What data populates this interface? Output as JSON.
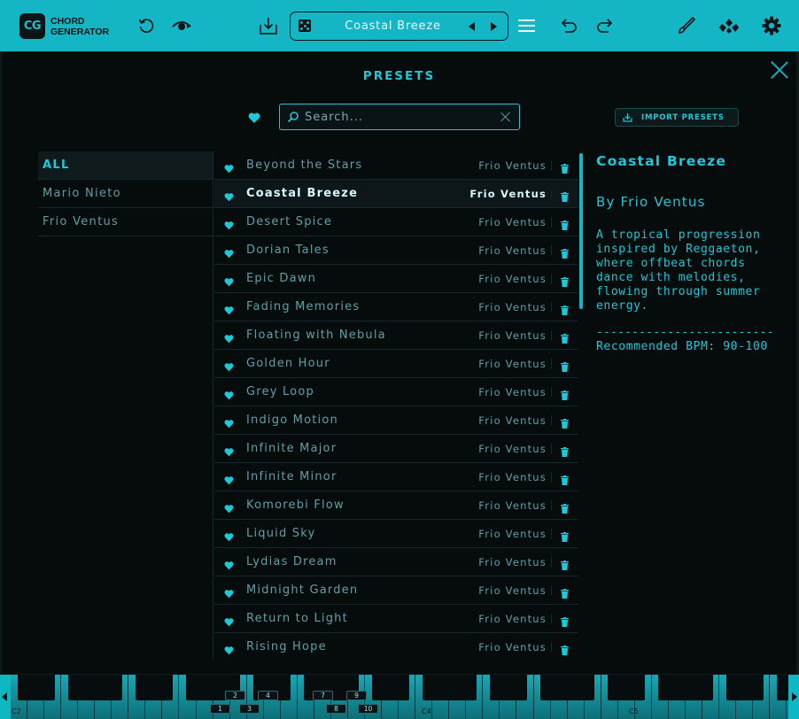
{
  "app": {
    "logo_badge": "CG",
    "logo_line1": "CHORD",
    "logo_line2": "GENERATOR"
  },
  "toolbar": {
    "current_preset": "Coastal Breeze"
  },
  "presets_panel": {
    "title": "PRESETS",
    "search_placeholder": "Search...",
    "import_label": "IMPORT PRESETS",
    "categories": [
      {
        "label": "ALL",
        "active": true
      },
      {
        "label": "Mario Nieto",
        "active": false
      },
      {
        "label": "Frio Ventus",
        "active": false
      }
    ],
    "presets": [
      {
        "name": "Beyond the Stars",
        "author": "Frio Ventus"
      },
      {
        "name": "Coastal Breeze",
        "author": "Frio Ventus",
        "selected": true
      },
      {
        "name": "Desert Spice",
        "author": "Frio Ventus"
      },
      {
        "name": "Dorian Tales",
        "author": "Frio Ventus"
      },
      {
        "name": "Epic Dawn",
        "author": "Frio Ventus"
      },
      {
        "name": "Fading Memories",
        "author": "Frio Ventus"
      },
      {
        "name": "Floating with Nebula",
        "author": "Frio Ventus"
      },
      {
        "name": "Golden Hour",
        "author": "Frio Ventus"
      },
      {
        "name": "Grey Loop",
        "author": "Frio Ventus"
      },
      {
        "name": "Indigo Motion",
        "author": "Frio Ventus"
      },
      {
        "name": "Infinite Major",
        "author": "Frio Ventus"
      },
      {
        "name": "Infinite Minor",
        "author": "Frio Ventus"
      },
      {
        "name": "Komorebi Flow",
        "author": "Frio Ventus"
      },
      {
        "name": "Liquid Sky",
        "author": "Frio Ventus"
      },
      {
        "name": "Lydias Dream",
        "author": "Frio Ventus"
      },
      {
        "name": "Midnight Garden",
        "author": "Frio Ventus"
      },
      {
        "name": "Return to Light",
        "author": "Frio Ventus"
      },
      {
        "name": "Rising Hope",
        "author": "Frio Ventus"
      }
    ],
    "detail": {
      "title": "Coastal Breeze",
      "author": "By Frio Ventus",
      "description": "A tropical progression inspired by Reggaeton, where offbeat chords dance with melodies, flowing through summer energy.",
      "rule": "-------------------------",
      "bpm": "Recommended BPM: 90-100"
    }
  },
  "keyboard": {
    "octave_labels": [
      "C2",
      "C4",
      "C5"
    ],
    "number_tags": [
      "1",
      "2",
      "3",
      "4",
      "7",
      "8",
      "9",
      "10"
    ]
  },
  "colors": {
    "accent": "#14b6c6",
    "panel_bg": "#060b0c",
    "text_dim": "#5fa0a8"
  }
}
